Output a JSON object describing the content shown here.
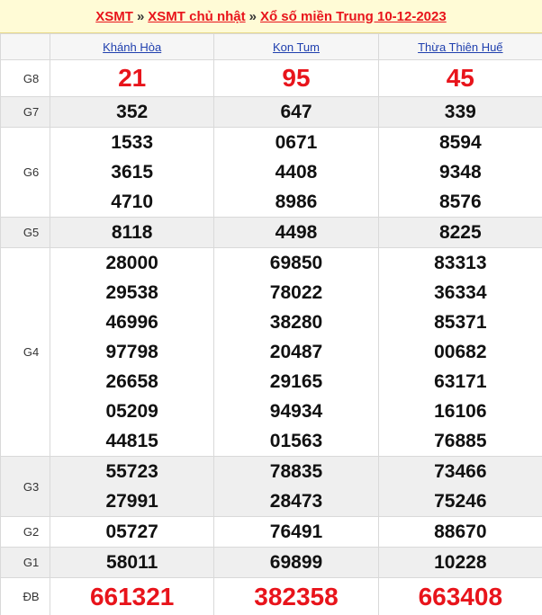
{
  "breadcrumb": {
    "link1": "XSMT",
    "sep1": "»",
    "link2": "XSMT chủ nhật",
    "sep2": "»",
    "link3": "Xổ số miền Trung 10-12-2023"
  },
  "provinces": [
    "Khánh Hòa",
    "Kon Tum",
    "Thừa Thiên Huế"
  ],
  "prizes": [
    {
      "label": "G8",
      "values": [
        [
          "21"
        ],
        [
          "95"
        ],
        [
          "45"
        ]
      ]
    },
    {
      "label": "G7",
      "values": [
        [
          "352"
        ],
        [
          "647"
        ],
        [
          "339"
        ]
      ]
    },
    {
      "label": "G6",
      "values": [
        [
          "1533",
          "3615",
          "4710"
        ],
        [
          "0671",
          "4408",
          "8986"
        ],
        [
          "8594",
          "9348",
          "8576"
        ]
      ]
    },
    {
      "label": "G5",
      "values": [
        [
          "8118"
        ],
        [
          "4498"
        ],
        [
          "8225"
        ]
      ]
    },
    {
      "label": "G4",
      "values": [
        [
          "28000",
          "29538",
          "46996",
          "97798",
          "26658",
          "05209",
          "44815"
        ],
        [
          "69850",
          "78022",
          "38280",
          "20487",
          "29165",
          "94934",
          "01563"
        ],
        [
          "83313",
          "36334",
          "85371",
          "00682",
          "63171",
          "16106",
          "76885"
        ]
      ]
    },
    {
      "label": "G3",
      "values": [
        [
          "55723",
          "27991"
        ],
        [
          "78835",
          "28473"
        ],
        [
          "73466",
          "75246"
        ]
      ]
    },
    {
      "label": "G2",
      "values": [
        [
          "05727"
        ],
        [
          "76491"
        ],
        [
          "88670"
        ]
      ]
    },
    {
      "label": "G1",
      "values": [
        [
          "58011"
        ],
        [
          "69899"
        ],
        [
          "10228"
        ]
      ]
    },
    {
      "label": "ĐB",
      "values": [
        [
          "661321"
        ],
        [
          "382358"
        ],
        [
          "663408"
        ]
      ]
    }
  ],
  "colors": {
    "accent_red": "#e8141b",
    "link_blue": "#1f3fae",
    "header_bg": "#fffbd6",
    "alt_row_bg": "#efefef"
  }
}
